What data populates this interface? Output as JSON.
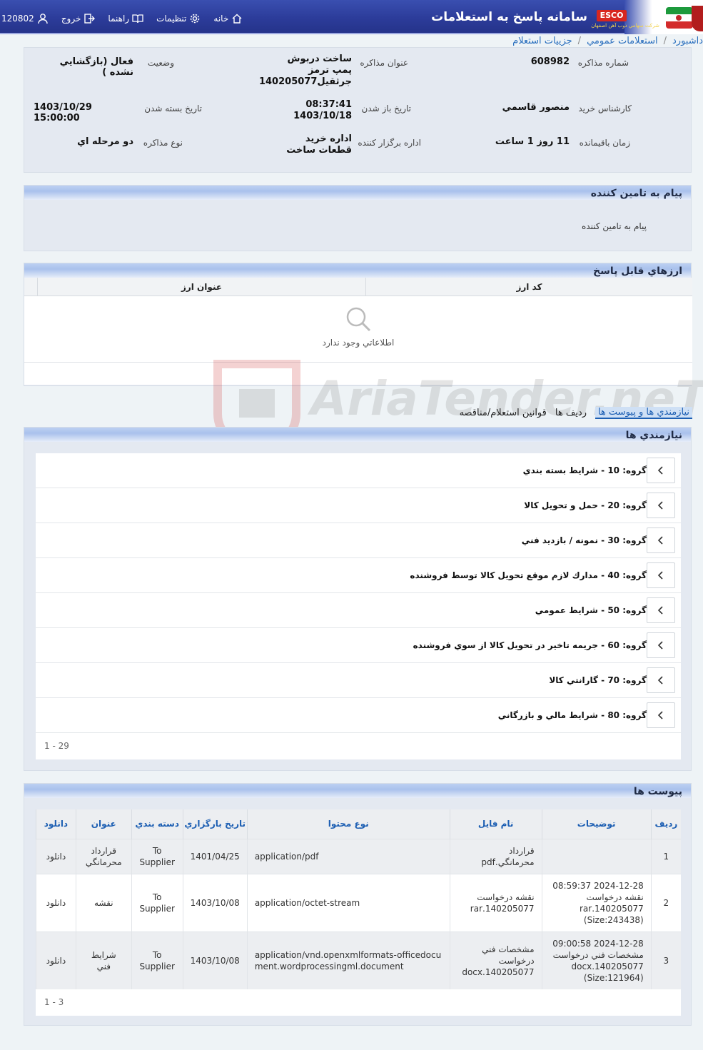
{
  "header": {
    "app_title": "سامانه پاسخ به استعلامات",
    "brand_badge": "ESCO",
    "brand_subtitle": "شركت سهامي ذوب آهن اصفهان",
    "nav": {
      "home": "خانه",
      "settings": "تنظيمات",
      "help": "راهنما",
      "logout": "خروج",
      "user_id": "120802"
    }
  },
  "breadcrumb": [
    "داشبورد",
    "استعلامات عمومي",
    "جزييات استعلام"
  ],
  "info": {
    "negotiation_number_label": "شماره مذاكره",
    "negotiation_number": "608982",
    "negotiation_title_label": "عنوان مذاكره",
    "negotiation_title": "ساخت دربوش پمپ ترمز جرثقيل140205077",
    "status_label": "وضعيت",
    "status": "فعال (بازگشايي نشده )",
    "buyer_expert_label": "كارشناس خريد",
    "buyer_expert": "منصور قاسمي",
    "open_date_label": "تاريخ باز شدن",
    "open_time": "08:37:41",
    "open_date": "1403/10/18",
    "close_date_label": "تاريخ بسته شدن",
    "close_date": "1403/10/29 15:00:00",
    "remaining_label": "زمان باقيمانده",
    "remaining": "11 روز 1 ساعت",
    "organizer_label": "اداره برگزار كننده",
    "organizer": "اداره خريد قطعات ساخت",
    "negotiation_type_label": "نوع مذاكره",
    "negotiation_type": "دو مرحله اي"
  },
  "supplier_message": {
    "title": "پيام به تامين كننده",
    "body": "پيام به تامين كننده"
  },
  "currencies": {
    "title": "ارزهاي قابل پاسخ",
    "columns": [
      "كد ارز",
      "عنوان ارز"
    ],
    "empty_text": "اطلاعاتي وجود ندارد"
  },
  "tabs": [
    "نيازمندي ها و پيوست ها",
    "رديف ها",
    "قوانين استعلام/مناقصه"
  ],
  "requirements": {
    "title": "نيازمندي ها",
    "items": [
      "گروه: 10 - شرايط بسته بندي",
      "گروه: 20 - حمل و تحويل كالا",
      "گروه: 30 - نمونه / بازديد فني",
      "گروه: 40 - مدارك لازم موقع تحويل كالا توسط فروشنده",
      "گروه: 50 - شرايط عمومي",
      "گروه: 60 - جريمه تاخير در تحويل كالا از سوي فروشنده",
      "گروه: 70 - گارانتي كالا",
      "گروه: 80 - شرايط مالي و بازرگاني"
    ],
    "pager": "1 - 29"
  },
  "attachments": {
    "title": "پيوست ها",
    "columns": [
      "رديف",
      "توضيحات",
      "نام فايل",
      "نوع محتوا",
      "تاريخ بارگزاري",
      "دسته بندي",
      "عنوان",
      "دانلود"
    ],
    "rows": [
      {
        "row": "1",
        "desc": "",
        "file": "قرارداد محرمانگي.pdf",
        "type": "application/pdf",
        "date": "1401/04/25",
        "category": "To Supplier",
        "title": "قرارداد محرمانگي",
        "download": "دانلود"
      },
      {
        "row": "2",
        "desc": "2024-12-28 08:59:37 نقشه درخواست 140205077.rar (Size:243438)",
        "file": "نقشه درخواست 140205077.rar",
        "type": "application/octet-stream",
        "date": "1403/10/08",
        "category": "To Supplier",
        "title": "نقشه",
        "download": "دانلود"
      },
      {
        "row": "3",
        "desc": "2024-12-28 09:00:58 مشخصات فني درخواست 140205077.docx (Size:121964)",
        "file": "مشخصات فني درخواست 140205077.docx",
        "type": "application/vnd.openxmlformats-officedocument.wordprocessingml.document",
        "date": "1403/10/08",
        "category": "To Supplier",
        "title": "شرايط فني",
        "download": "دانلود"
      }
    ],
    "pager": "1 - 3"
  },
  "watermark": "AriaTender.neT",
  "colors": {
    "header": "#2c3c9a",
    "link": "#1d5fb3",
    "panel": "#e4e9f1"
  }
}
